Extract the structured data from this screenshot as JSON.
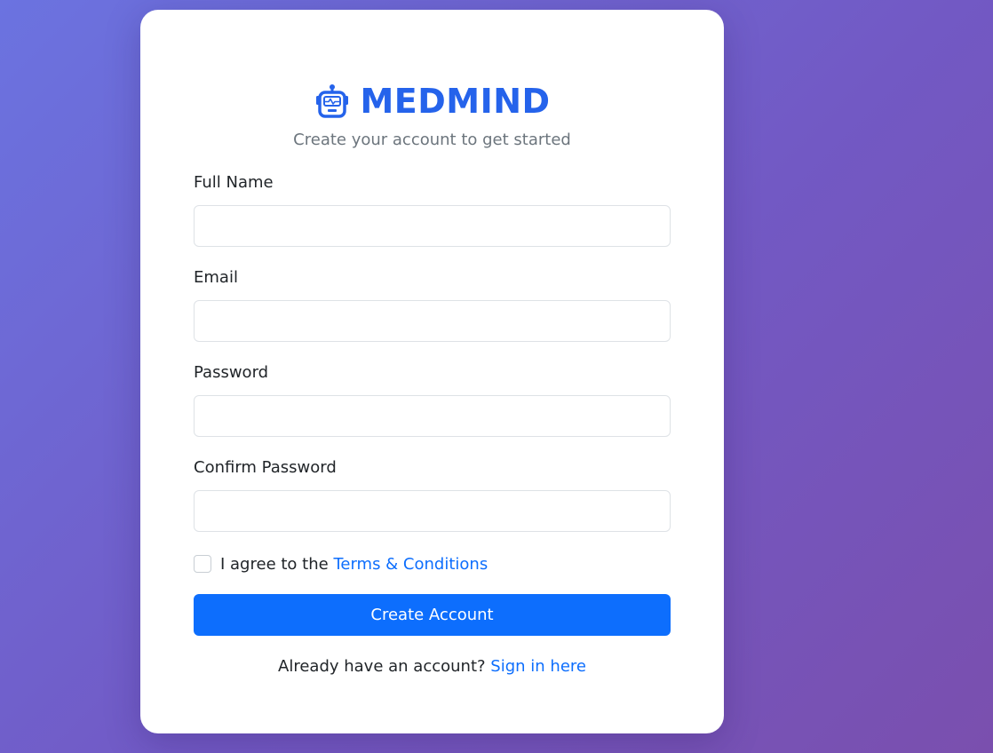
{
  "colors": {
    "brand": "#2563eb",
    "primary_button": "#0d6efd",
    "link": "#0d6efd",
    "background_start": "#6b73e0",
    "background_end": "#7a4fae"
  },
  "brand": {
    "icon": "robot-icon",
    "name": "MEDMIND"
  },
  "subtitle": "Create your account to get started",
  "form": {
    "full_name": {
      "label": "Full Name",
      "value": "",
      "placeholder": ""
    },
    "email": {
      "label": "Email",
      "value": "",
      "placeholder": ""
    },
    "password": {
      "label": "Password",
      "value": "",
      "placeholder": ""
    },
    "confirm_password": {
      "label": "Confirm Password",
      "value": "",
      "placeholder": ""
    },
    "terms": {
      "checked": false,
      "prefix": "I agree to the",
      "link_label": "Terms & Conditions"
    },
    "submit_label": "Create Account"
  },
  "signin": {
    "prompt": "Already have an account?",
    "link_label": "Sign in here"
  }
}
